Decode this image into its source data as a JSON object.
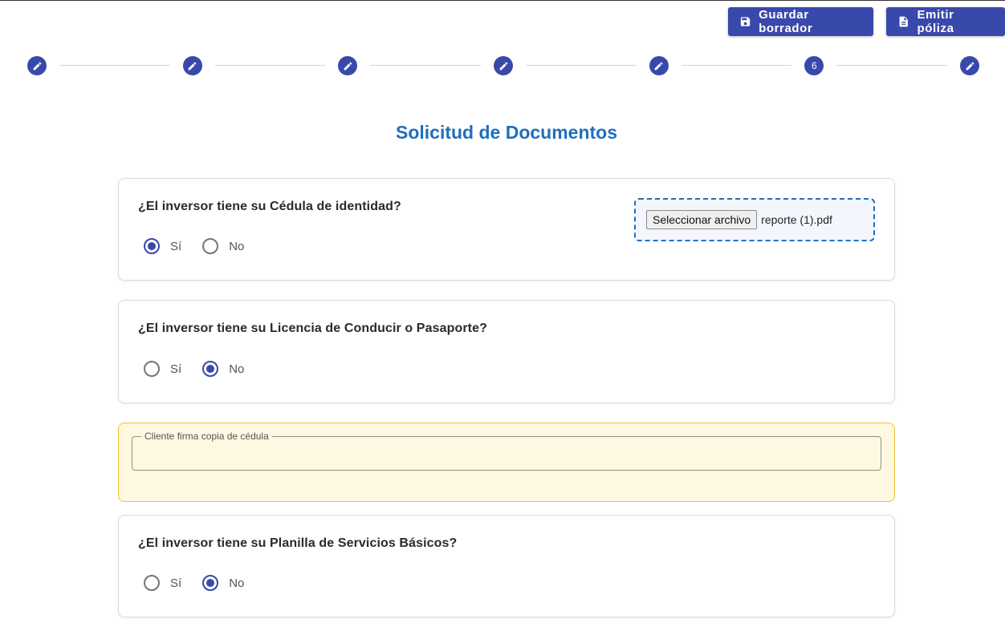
{
  "toolbar": {
    "draft_label": "Guardar borrador",
    "issue_label": "Emitir póliza"
  },
  "stepper": {
    "steps": [
      {
        "type": "edit",
        "label": ""
      },
      {
        "type": "edit",
        "label": ""
      },
      {
        "type": "edit",
        "label": ""
      },
      {
        "type": "edit",
        "label": ""
      },
      {
        "type": "edit",
        "label": ""
      },
      {
        "type": "number",
        "label": "6"
      },
      {
        "type": "edit",
        "label": ""
      }
    ]
  },
  "page": {
    "title": "Solicitud de Documentos"
  },
  "questions": [
    {
      "text": "¿El inversor tiene su Cédula de identidad?",
      "options": [
        "Sí",
        "No"
      ],
      "selected": "Sí",
      "file": {
        "button_label": "Seleccionar archivo",
        "filename": "reporte (1).pdf"
      }
    },
    {
      "text": "¿El inversor tiene su Licencia de Conducir o Pasaporte?",
      "options": [
        "Sí",
        "No"
      ],
      "selected": "No"
    },
    {
      "text": "¿El inversor tiene su Planilla de Servicios Básicos?",
      "options": [
        "Sí",
        "No"
      ],
      "selected": "No"
    }
  ],
  "signature_field": {
    "label": "Cliente firma copia de cédula",
    "value": ""
  },
  "colors": {
    "primary": "#3949ab",
    "title": "#1f6fbf",
    "warning_bg": "#fff8e1",
    "warning_border": "#f1c232"
  }
}
